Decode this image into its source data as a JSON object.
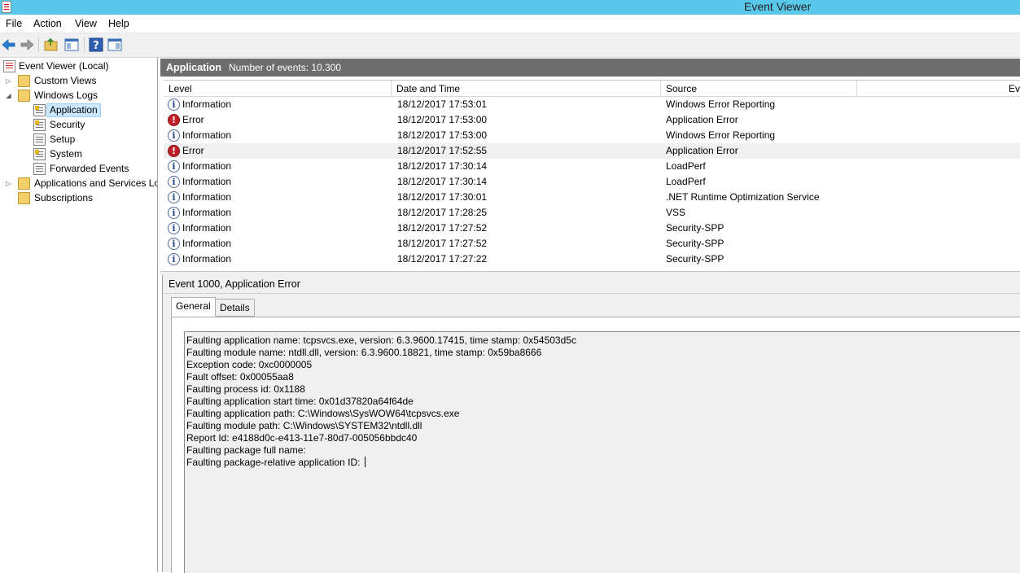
{
  "window": {
    "title": "Event Viewer"
  },
  "menu": [
    "File",
    "Action",
    "View",
    "Help"
  ],
  "toolbar": {
    "buttons": [
      "back-arrow-icon",
      "forward-arrow-icon",
      "folder-up-icon",
      "console-pane-icon",
      "help-icon",
      "action-pane-icon"
    ]
  },
  "tree": {
    "root": "Event Viewer (Local)",
    "custom_views": "Custom Views",
    "windows_logs": "Windows Logs",
    "logs": [
      "Application",
      "Security",
      "Setup",
      "System",
      "Forwarded Events"
    ],
    "apps_services": "Applications and Services Lo",
    "subscriptions": "Subscriptions",
    "selected": "Application"
  },
  "log_header": {
    "name": "Application",
    "count_text": "Number of events: 10.300"
  },
  "columns": [
    "Level",
    "Date and Time",
    "Source",
    "Ev"
  ],
  "events": [
    {
      "level": "Information",
      "date": "18/12/2017 17:53:01",
      "source": "Windows Error Reporting"
    },
    {
      "level": "Error",
      "date": "18/12/2017 17:53:00",
      "source": "Application Error"
    },
    {
      "level": "Information",
      "date": "18/12/2017 17:53:00",
      "source": "Windows Error Reporting"
    },
    {
      "level": "Error",
      "date": "18/12/2017 17:52:55",
      "source": "Application Error"
    },
    {
      "level": "Information",
      "date": "18/12/2017 17:30:14",
      "source": "LoadPerf"
    },
    {
      "level": "Information",
      "date": "18/12/2017 17:30:14",
      "source": "LoadPerf"
    },
    {
      "level": "Information",
      "date": "18/12/2017 17:30:01",
      "source": ".NET Runtime Optimization Service"
    },
    {
      "level": "Information",
      "date": "18/12/2017 17:28:25",
      "source": "VSS"
    },
    {
      "level": "Information",
      "date": "18/12/2017 17:27:52",
      "source": "Security-SPP"
    },
    {
      "level": "Information",
      "date": "18/12/2017 17:27:52",
      "source": "Security-SPP"
    },
    {
      "level": "Information",
      "date": "18/12/2017 17:27:22",
      "source": "Security-SPP"
    }
  ],
  "selected_event_index": 3,
  "detail": {
    "title": "Event 1000, Application Error",
    "tabs": [
      "General",
      "Details"
    ],
    "active_tab": "General",
    "lines": [
      "Faulting application name: tcpsvcs.exe, version: 6.3.9600.17415, time stamp: 0x54503d5c",
      "Faulting module name: ntdll.dll, version: 6.3.9600.18821, time stamp: 0x59ba8666",
      "Exception code: 0xc0000005",
      "Fault offset: 0x00055aa8",
      "Faulting process id: 0x1188",
      "Faulting application start time: 0x01d37820a64f64de",
      "Faulting application path: C:\\Windows\\SysWOW64\\tcpsvcs.exe",
      "Faulting module path: C:\\Windows\\SYSTEM32\\ntdll.dll",
      "Report Id: e4188d0c-e413-11e7-80d7-005056bbdc40",
      "Faulting package full name: ",
      "Faulting package-relative application ID: "
    ]
  },
  "colors": {
    "titlebar": "#5ac8ea",
    "header_bar": "#6d6d6d",
    "selection": "#cce8ff",
    "error": "#c0202a"
  }
}
